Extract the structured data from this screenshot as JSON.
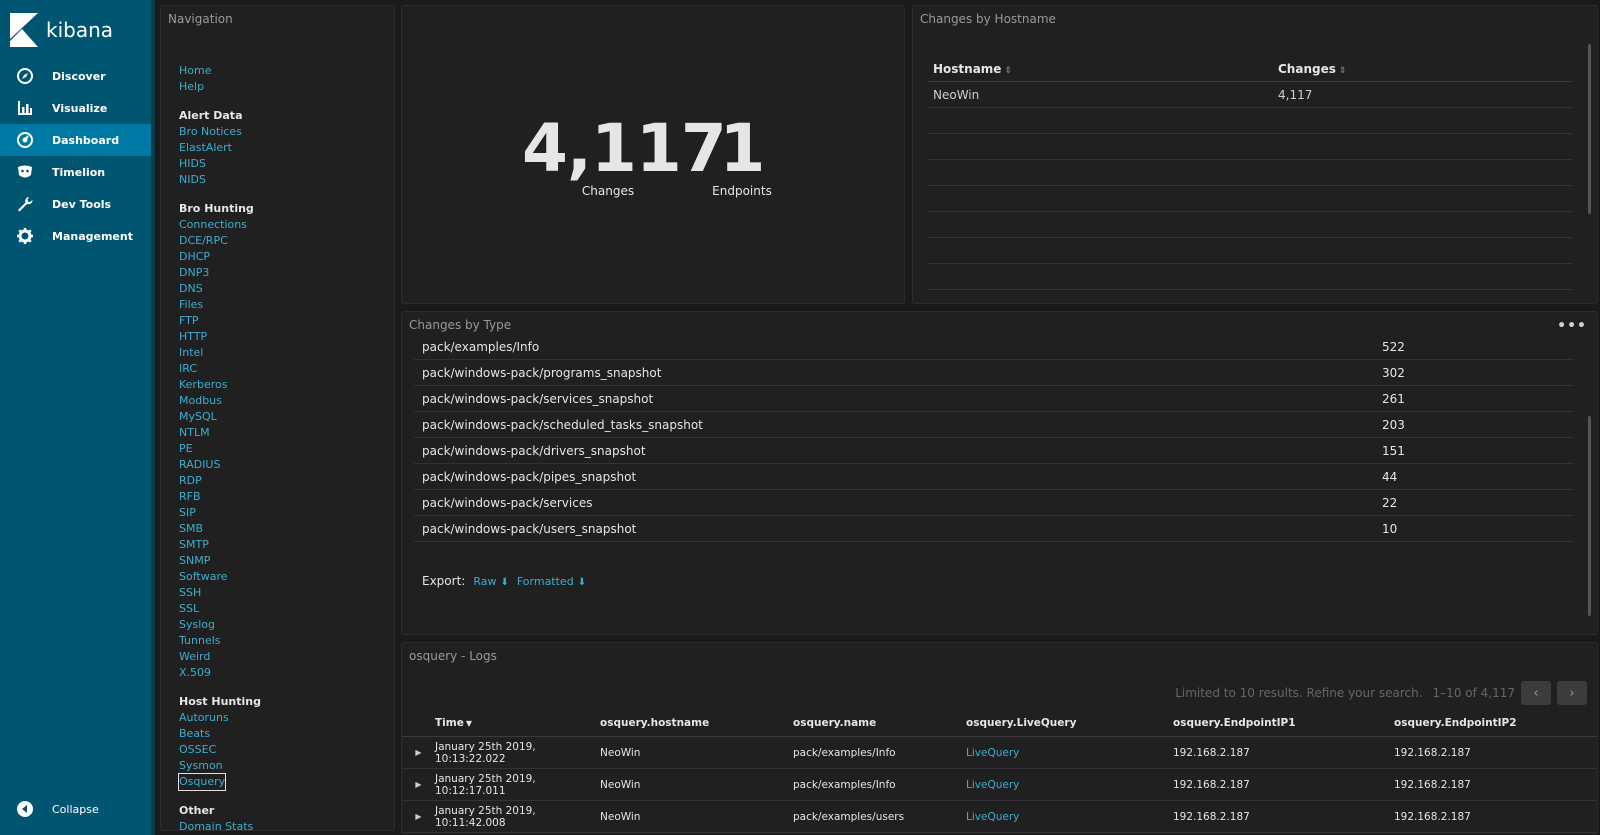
{
  "brand": {
    "name": "kibana"
  },
  "sidenav": {
    "items": [
      {
        "label": "Discover",
        "icon": "compass-icon"
      },
      {
        "label": "Visualize",
        "icon": "bar-chart-icon"
      },
      {
        "label": "Dashboard",
        "icon": "dashboard-icon",
        "active": true
      },
      {
        "label": "Timelion",
        "icon": "timelion-icon"
      },
      {
        "label": "Dev Tools",
        "icon": "wrench-icon"
      },
      {
        "label": "Management",
        "icon": "gear-icon"
      }
    ],
    "collapse_label": "Collapse"
  },
  "navigation_panel": {
    "title": "Navigation",
    "top_links": [
      "Home",
      "Help"
    ],
    "alert_data": {
      "header": "Alert Data",
      "links": [
        "Bro Notices",
        "ElastAlert",
        "HIDS",
        "NIDS"
      ]
    },
    "bro_hunting": {
      "header": "Bro Hunting",
      "links": [
        "Connections",
        "DCE/RPC",
        "DHCP",
        "DNP3",
        "DNS",
        "Files",
        "FTP",
        "HTTP",
        "Intel",
        "IRC",
        "Kerberos",
        "Modbus",
        "MySQL",
        "NTLM",
        "PE",
        "RADIUS",
        "RDP",
        "RFB",
        "SIP",
        "SMB",
        "SMTP",
        "SNMP",
        "Software",
        "SSH",
        "SSL",
        "Syslog",
        "Tunnels",
        "Weird",
        "X.509"
      ]
    },
    "host_hunting": {
      "header": "Host Hunting",
      "links": [
        "Autoruns",
        "Beats",
        "OSSEC",
        "Sysmon"
      ],
      "selected_link": "Osquery"
    },
    "other": {
      "header": "Other",
      "links": [
        "Domain Stats"
      ]
    }
  },
  "metric_panel": {
    "changes": {
      "value": "4,117",
      "label": "Changes"
    },
    "endpoints": {
      "value": "1",
      "label": "Endpoints"
    }
  },
  "hostname_panel": {
    "title": "Changes by Hostname",
    "columns": [
      "Hostname",
      "Changes"
    ],
    "rows": [
      {
        "hostname": "NeoWin",
        "changes": "4,117"
      }
    ]
  },
  "type_panel": {
    "title": "Changes by Type",
    "menu": "•••",
    "rows": [
      {
        "name": "pack/examples/Info",
        "count": "522"
      },
      {
        "name": "pack/windows-pack/programs_snapshot",
        "count": "302"
      },
      {
        "name": "pack/windows-pack/services_snapshot",
        "count": "261"
      },
      {
        "name": "pack/windows-pack/scheduled_tasks_snapshot",
        "count": "203"
      },
      {
        "name": "pack/windows-pack/drivers_snapshot",
        "count": "151"
      },
      {
        "name": "pack/windows-pack/pipes_snapshot",
        "count": "44"
      },
      {
        "name": "pack/windows-pack/services",
        "count": "22"
      },
      {
        "name": "pack/windows-pack/users_snapshot",
        "count": "10"
      }
    ],
    "export": {
      "label": "Export:",
      "raw": "Raw",
      "formatted": "Formatted"
    }
  },
  "logs_panel": {
    "title": "osquery - Logs",
    "pager_text": "Limited to 10 results. Refine your search.",
    "pager_range": "1–10 of 4,117",
    "columns": [
      "Time",
      "osquery.hostname",
      "osquery.name",
      "osquery.LiveQuery",
      "osquery.EndpointIP1",
      "osquery.EndpointIP2"
    ],
    "rows": [
      {
        "time": "January 25th 2019, 10:13:22.022",
        "hostname": "NeoWin",
        "name": "pack/examples/Info",
        "livequery": "LiveQuery",
        "ip1": "192.168.2.187",
        "ip2": "192.168.2.187"
      },
      {
        "time": "January 25th 2019, 10:12:17.011",
        "hostname": "NeoWin",
        "name": "pack/examples/Info",
        "livequery": "LiveQuery",
        "ip1": "192.168.2.187",
        "ip2": "192.168.2.187"
      },
      {
        "time": "January 25th 2019, 10:11:42.008",
        "hostname": "NeoWin",
        "name": "pack/examples/users",
        "livequery": "LiveQuery",
        "ip1": "192.168.2.187",
        "ip2": "192.168.2.187"
      }
    ]
  },
  "colors": {
    "nav_bg": "#005571",
    "nav_active": "#0079a5",
    "panel_bg": "#202020",
    "link": "#3caed2"
  }
}
